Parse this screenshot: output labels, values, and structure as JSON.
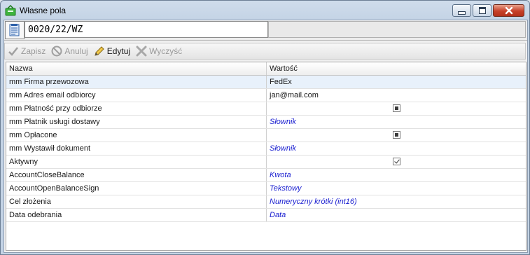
{
  "window": {
    "title": "Własne pola",
    "minimize_icon": "minimize-icon",
    "maximize_icon": "maximize-icon",
    "close_icon": "close-icon"
  },
  "document": {
    "number": "0020/22/WZ",
    "icon": "document-icon"
  },
  "toolbar": {
    "save_label": "Zapisz",
    "cancel_label": "Anuluj",
    "edit_label": "Edytuj",
    "clear_label": "Wyczyść"
  },
  "grid": {
    "columns": [
      "Nazwa",
      "Wartość"
    ],
    "rows": [
      {
        "name": "mm Firma przewozowa",
        "value": "FedEx",
        "type": "text",
        "selected": true
      },
      {
        "name": "mm Adres email odbiorcy",
        "value": "jan@mail.com",
        "type": "text"
      },
      {
        "name": "mm Płatność przy odbiorze",
        "value": "",
        "type": "checkbox-indeterminate"
      },
      {
        "name": "mm Płatnik usługi dostawy",
        "value": "Słownik",
        "type": "hint"
      },
      {
        "name": "mm Opłacone",
        "value": "",
        "type": "checkbox-indeterminate"
      },
      {
        "name": "mm Wystawił dokument",
        "value": "Słownik",
        "type": "hint"
      },
      {
        "name": "Aktywny",
        "value": "",
        "type": "checkbox-checked"
      },
      {
        "name": "AccountCloseBalance",
        "value": "Kwota",
        "type": "hint"
      },
      {
        "name": "AccountOpenBalanceSign",
        "value": "Tekstowy",
        "type": "hint"
      },
      {
        "name": "Cel złożenia",
        "value": "Numeryczny krótki (int16)",
        "type": "hint"
      },
      {
        "name": "Data odebrania",
        "value": "Data",
        "type": "hint"
      }
    ]
  },
  "colors": {
    "link_value": "#1a1fd0",
    "selected_row": "#e8f1fb",
    "close_button": "#c7412a"
  }
}
